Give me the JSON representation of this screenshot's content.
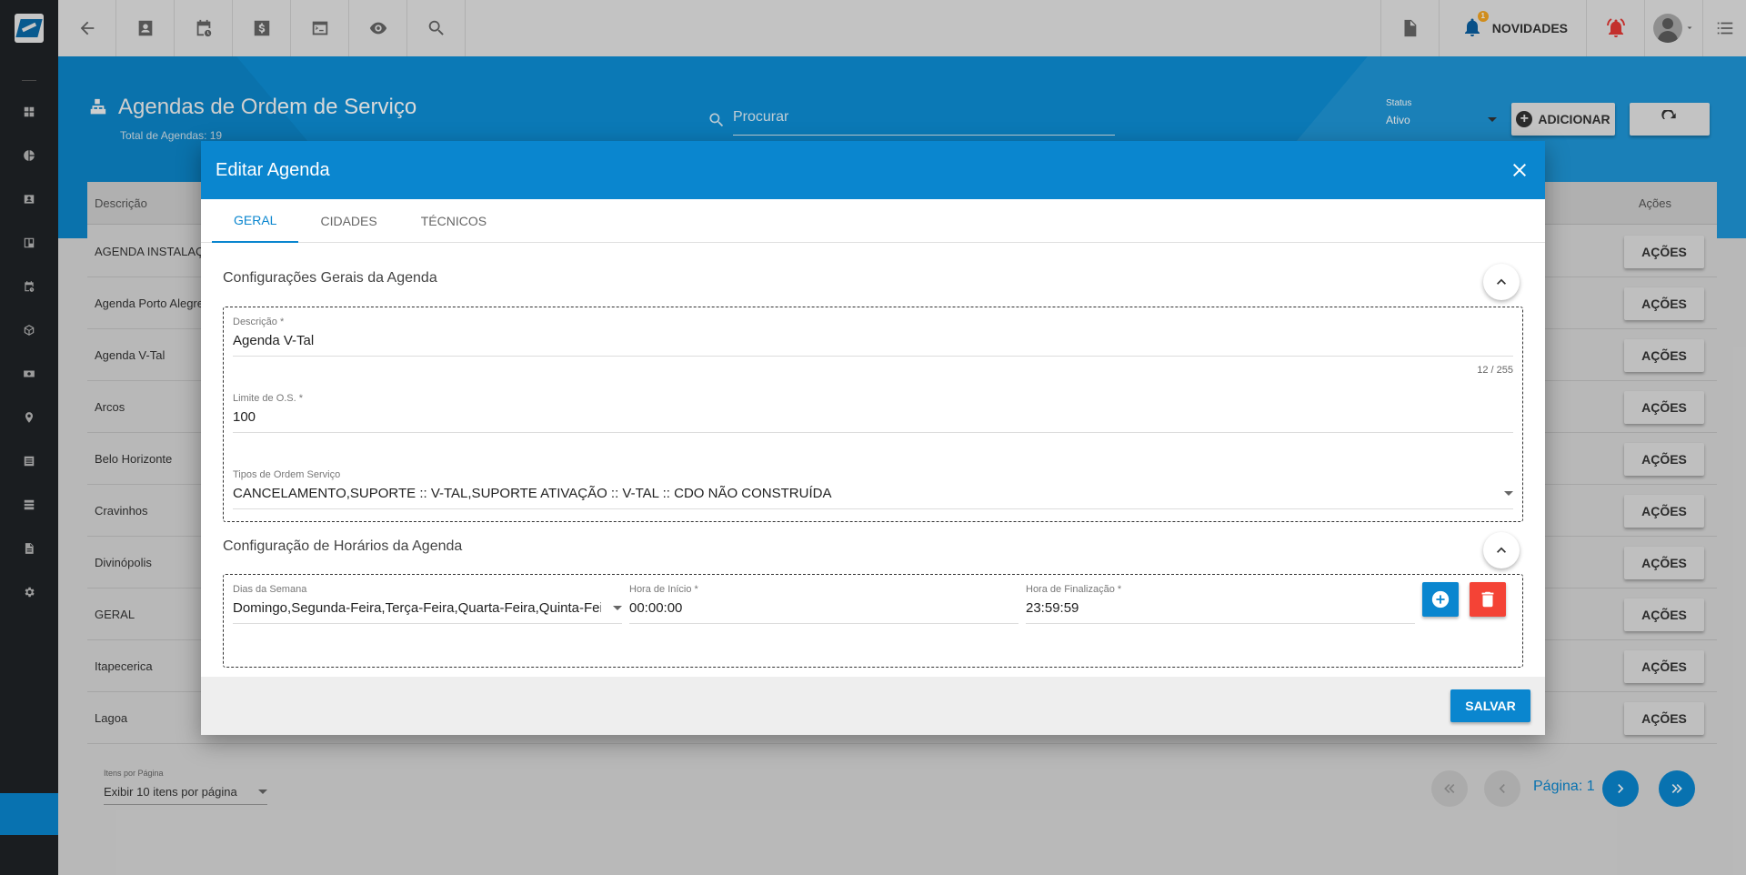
{
  "topbar": {
    "novidades_label": "NOVIDADES",
    "notification_count": "1"
  },
  "page": {
    "title": "Agendas de Ordem de Serviço",
    "subtitle": "Total de Agendas: 19",
    "search_placeholder": "Procurar",
    "status_label": "Status",
    "status_value": "Ativo",
    "add_label": "ADICIONAR"
  },
  "table": {
    "col_desc": "Descrição",
    "col_actions": "Ações",
    "action_label": "AÇÕES",
    "rows": [
      "AGENDA INSTALAÇ",
      "Agenda Porto Alegre",
      "Agenda V-Tal",
      "Arcos",
      "Belo Horizonte",
      "Cravinhos",
      "Divinópolis",
      "GERAL",
      "Itapecerica",
      "Lagoa"
    ]
  },
  "pagination": {
    "label": "Itens por Página",
    "value": "Exibir 10 itens por página",
    "page_text": "Página: 1"
  },
  "modal": {
    "title": "Editar Agenda",
    "tabs": [
      "GERAL",
      "CIDADES",
      "TÉCNICOS"
    ],
    "section1": "Configurações Gerais da Agenda",
    "descricao_label": "Descrição *",
    "descricao_value": "Agenda V-Tal",
    "descricao_counter": "12 / 255",
    "limite_label": "Limite de O.S. *",
    "limite_value": "100",
    "tipos_label": "Tipos de Ordem Serviço",
    "tipos_value": "CANCELAMENTO,SUPORTE :: V-TAL,SUPORTE ATIVAÇÃO :: V-TAL :: CDO NÃO CONSTRUÍDA",
    "section2": "Configuração de Horários da Agenda",
    "dias_label": "Dias da Semana",
    "dias_value": "Domingo,Segunda-Feira,Terça-Feira,Quarta-Feira,Quinta-Feira",
    "inicio_label": "Hora de Início *",
    "inicio_value": "00:00:00",
    "fim_label": "Hora de Finalização *",
    "fim_value": "23:59:59",
    "save_label": "SALVAR"
  },
  "colors": {
    "primary": "#0a86cf",
    "danger": "#f44336",
    "sidebar": "#1f2326"
  }
}
